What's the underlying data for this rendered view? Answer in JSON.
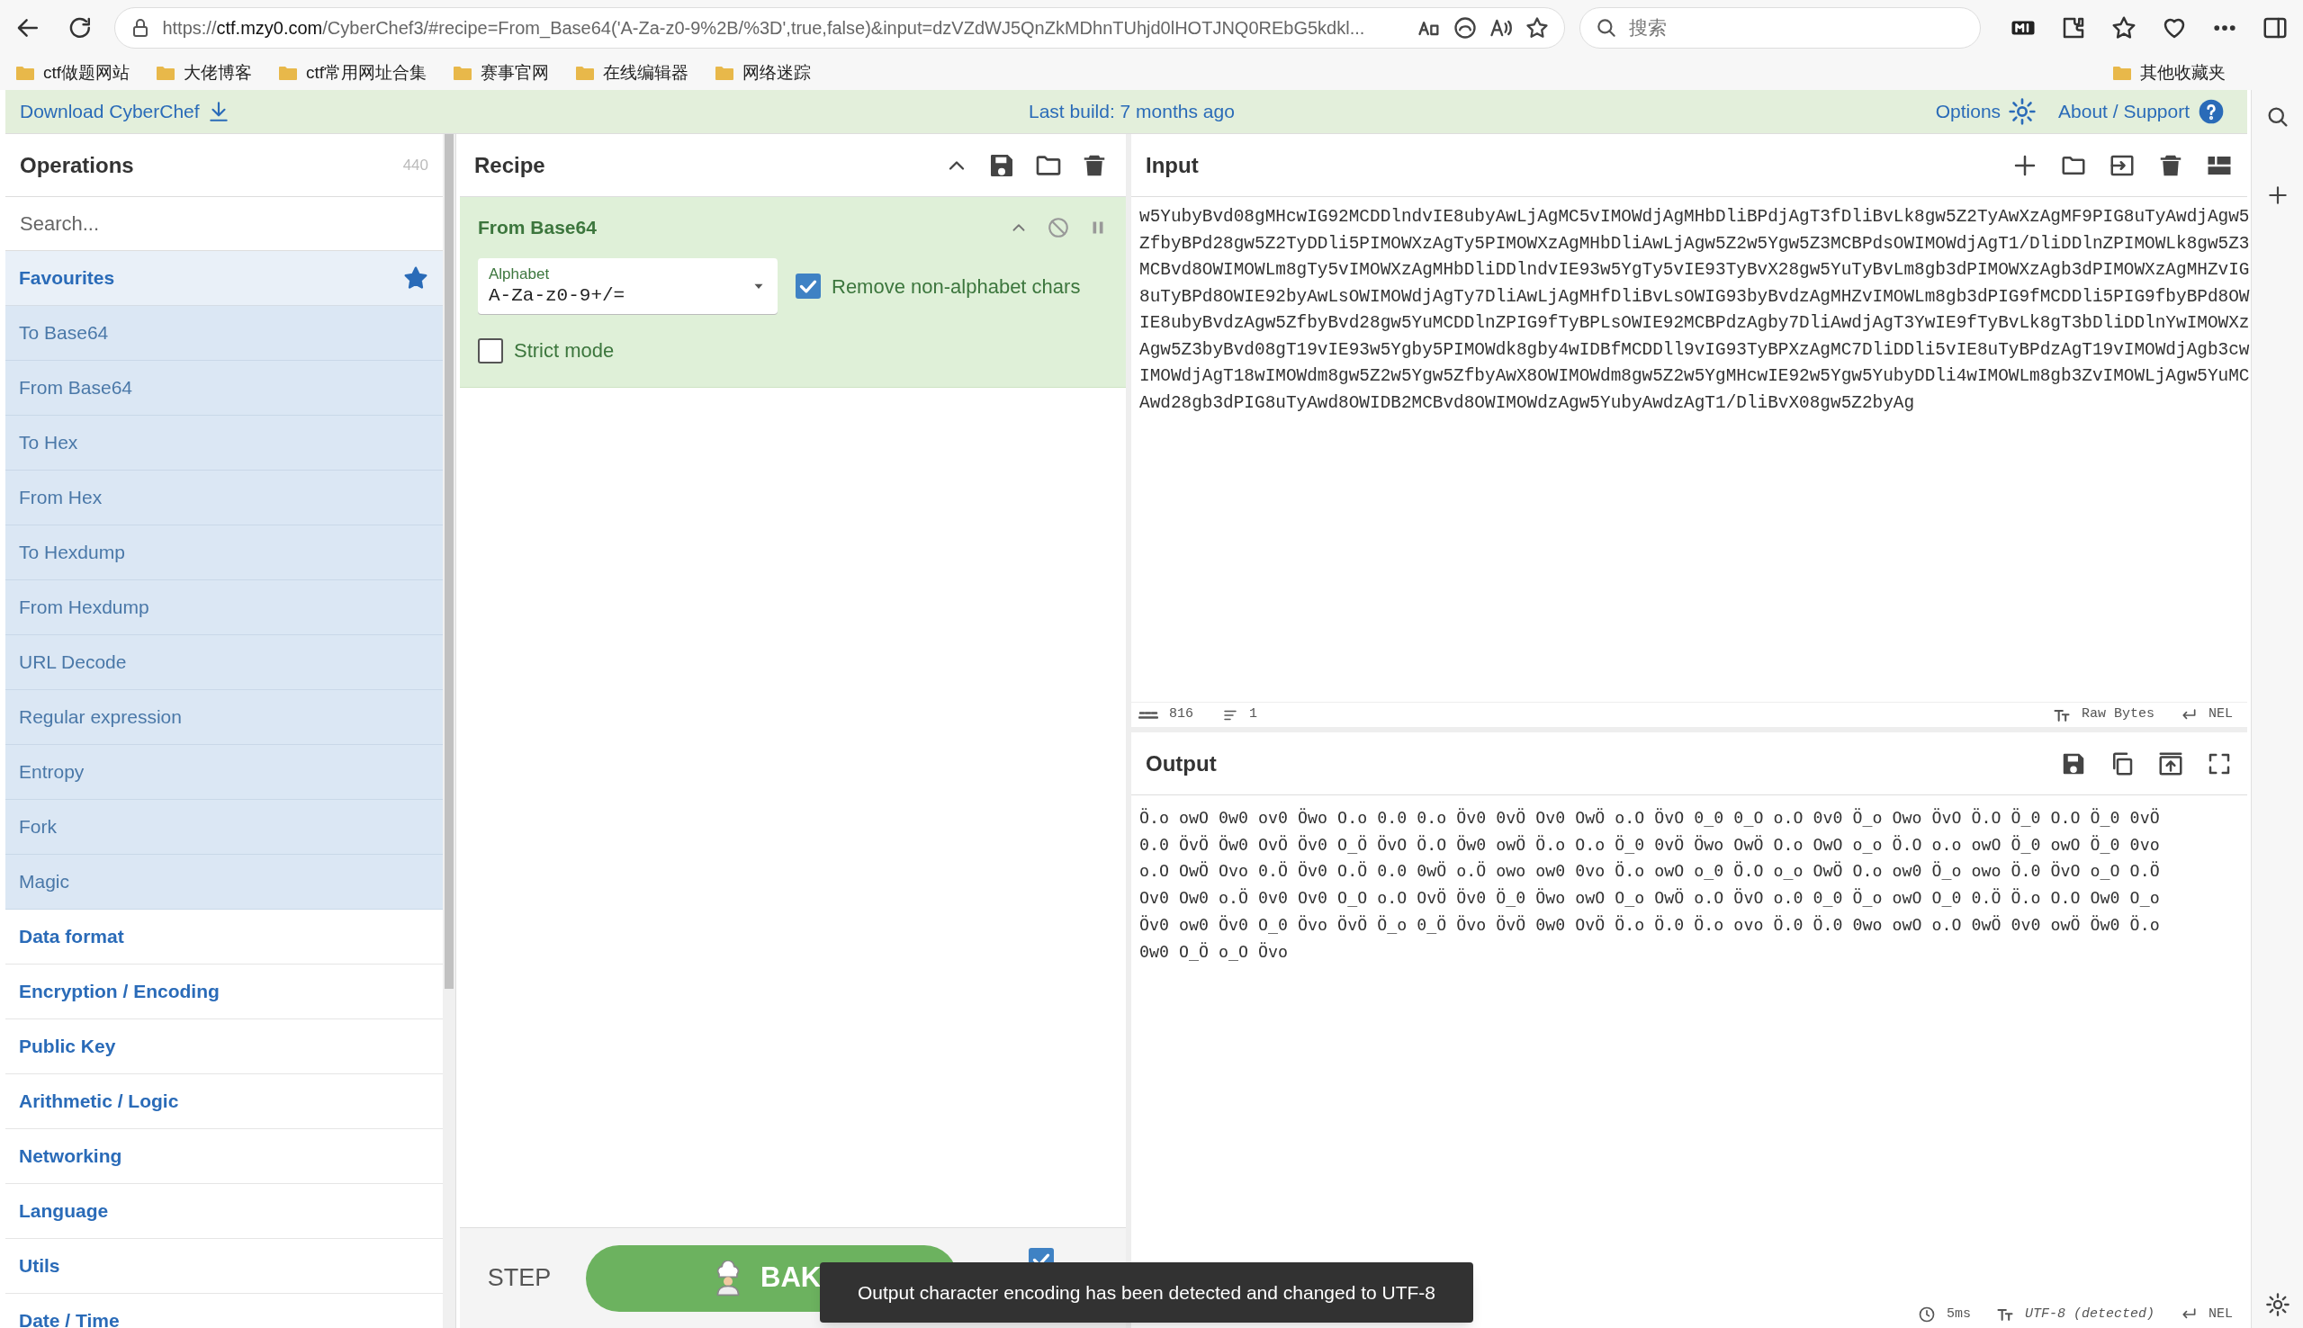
{
  "browser": {
    "url_scheme": "https://",
    "url_host": "ctf.mzy0.com",
    "url_path": "/CyberChef3/#recipe=From_Base64('A-Za-z0-9%2B/%3D',true,false)&input=dzVZdWJ5QnZkMDhnTUhjd0lHOTJNQ0REbG5kdkl...",
    "search_placeholder": "搜索",
    "bookmarks": [
      "ctf做题网站",
      "大佬博客",
      "ctf常用网址合集",
      "赛事官网",
      "在线编辑器",
      "网络迷踪"
    ],
    "other_bookmarks": "其他收藏夹"
  },
  "banner": {
    "download": "Download CyberChef",
    "last_build": "Last build: 7 months ago",
    "options": "Options",
    "about": "About / Support"
  },
  "operations": {
    "title": "Operations",
    "count": "440",
    "search_placeholder": "Search...",
    "items": [
      {
        "label": "Favourites",
        "kind": "favourites"
      },
      {
        "label": "To Base64",
        "kind": "operation"
      },
      {
        "label": "From Base64",
        "kind": "operation"
      },
      {
        "label": "To Hex",
        "kind": "operation"
      },
      {
        "label": "From Hex",
        "kind": "operation"
      },
      {
        "label": "To Hexdump",
        "kind": "operation"
      },
      {
        "label": "From Hexdump",
        "kind": "operation"
      },
      {
        "label": "URL Decode",
        "kind": "operation"
      },
      {
        "label": "Regular expression",
        "kind": "operation"
      },
      {
        "label": "Entropy",
        "kind": "operation"
      },
      {
        "label": "Fork",
        "kind": "operation"
      },
      {
        "label": "Magic",
        "kind": "operation"
      },
      {
        "label": "Data format",
        "kind": "category"
      },
      {
        "label": "Encryption / Encoding",
        "kind": "category"
      },
      {
        "label": "Public Key",
        "kind": "category"
      },
      {
        "label": "Arithmetic / Logic",
        "kind": "category"
      },
      {
        "label": "Networking",
        "kind": "category"
      },
      {
        "label": "Language",
        "kind": "category"
      },
      {
        "label": "Utils",
        "kind": "category"
      },
      {
        "label": "Date / Time",
        "kind": "category"
      }
    ]
  },
  "recipe": {
    "title": "Recipe",
    "operations": [
      {
        "name": "From Base64",
        "args": [
          {
            "kind": "dropdown",
            "label": "Alphabet",
            "value": "A-Za-z0-9+/="
          },
          {
            "kind": "checkbox",
            "label": "Remove non-alphabet chars",
            "checked": true
          },
          {
            "kind": "checkbox",
            "label": "Strict mode",
            "checked": false
          }
        ]
      }
    ],
    "step": "STEP",
    "bake": "BAK",
    "auto_bake_checked": true
  },
  "input": {
    "title": "Input",
    "lines": [
      "w5YubyBvd08gMHcwIG92MCDDlndvIE8ubyAwLjAgMC5vIMOWdjAgMHbDliBPdjAgT3fDliBvLk8gw5Z2TyAwXzAgMF9PIG8uTyAwdjAgw5",
      "ZfbyBPd28gw5Z2TyDDli5PIMOWXzAgTy5PIMOWXzAgMHbDliAwLjAgw5Z2w5Ygw5Z3MCBPdsOWIMOWdjAgT1/DliDDlnZPIMOWLk8gw5Z3",
      "MCBvd8OWIMOWLm8gTy5vIMOWXzAgMHbDliDDlndvIE93w5YgTy5vIE93TyBvX28gw5YuTyBvLm8gb3dPIMOWXzAgb3dPIMOWXzAgMHZvIG",
      "8uTyBPd8OWIE92byAwLsOWIMOWdjAgTy7DliAwLjAgMHfDliBvLsOWIG93byBvdzAgMHZvIMOWLm8gb3dPIG9fMCDDli5PIG9fbyBPd8OW",
      "IE8ubyBvdzAgw5ZfbyBvd28gw5YuMCDDlnZPIG9fTyBPLsOWIE92MCBPdzAgby7DliAwdjAgT3YwIE9fTyBvLk8gT3bDliDDlnYwIMOWXz",
      "Agw5Z3byBvd08gT19vIE93w5Ygby5PIMOWdk8gby4wIDBfMCDDll9vIG93TyBPXzAgMC7DliDDli5vIE8uTyBPdzAgT19vIMOWdjAgb3cw",
      "IMOWdjAgT18wIMOWdm8gw5Z2w5Ygw5ZfbyAwX8OWIMOWdm8gw5Z2w5YgMHcwIE92w5Ygw5YubyDDli4wIMOWLm8gb3ZvIMOWLjAgw5YuMC",
      "Awd28gb3dPIG8uTyAwd8OWIDB2MCBvd8OWIMOWdzAgw5YubyAwdzAgT1/DliBvX08gw5Z2byAg"
    ],
    "length": "816",
    "line_count": "1",
    "encoding": "Raw Bytes",
    "eol": "NEL"
  },
  "output": {
    "title": "Output",
    "lines": [
      "Ö.o owO 0w0 ov0 Öwo O.o 0.0 0.o Öv0 0vÖ Ov0 OwÖ o.O ÖvO 0_0 0_O o.O 0v0 Ö_o Owo ÖvO Ö.O Ö_0 O.O Ö_0 0vÖ",
      "0.0 ÖvÖ Öw0 OvÖ Öv0 O_Ö ÖvO Ö.O Öw0 owÖ Ö.o O.o Ö_0 0vÖ Öwo OwÖ O.o OwO o_o Ö.O o.o owO Ö_0 owO Ö_0 0vo",
      "o.O OwÖ Ovo 0.Ö Öv0 O.Ö 0.0 0wÖ o.Ö owo ow0 0vo Ö.o owO o_0 Ö.O o_o OwÖ O.o ow0 Ö_o owo Ö.0 ÖvO o_O O.Ö",
      "Ov0 Ow0 o.Ö 0v0 Ov0 O_O o.O OvÖ Öv0 Ö_0 Öwo owO O_o OwÖ o.O ÖvO o.0 0_0 Ö_o owO O_0 0.Ö Ö.o O.O Ow0 O_o",
      "Öv0 ow0 Öv0 O_0 Övo ÖvÖ Ö_o 0_Ö Övo ÖvÖ 0w0 OvÖ Ö.o Ö.0 Ö.o ovo Ö.0 Ö.0 0wo owO o.O 0wÖ 0v0 owÖ Öw0 Ö.o",
      "0w0 O_Ö o_O Övo"
    ],
    "time": "5ms",
    "encoding": "UTF-8 (detected)",
    "eol": "NEL"
  },
  "toast": "Output character encoding has been detected and changed to UTF-8"
}
